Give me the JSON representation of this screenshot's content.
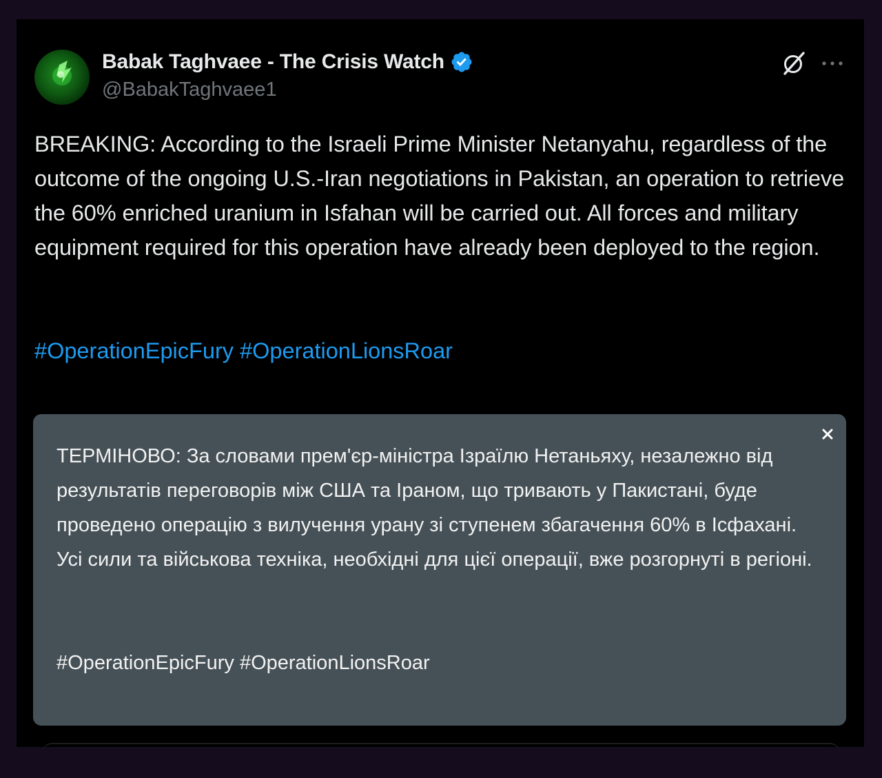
{
  "author": {
    "display_name": "Babak Taghvaee - The Crisis Watch",
    "handle": "@BabakTaghvaee1",
    "verified": true,
    "verified_color": "#1d9bf0"
  },
  "tweet": {
    "text": "BREAKING: According to the Israeli Prime Minister Netanyahu, regardless of the outcome of the ongoing U.S.-Iran negotiations in Pakistan, an operation to retrieve the 60% enriched uranium in Isfahan will be carried out. All forces and military equipment required for this operation have already been deployed to the region.",
    "hashtags": [
      "#OperationEpicFury",
      "#OperationLionsRoar"
    ],
    "hashtag_color": "#1d9bf0"
  },
  "translation": {
    "text": "ТЕРМІНОВО: За словами прем'єр-міністра Ізраїлю Нетаньяху, незалежно від результатів переговорів між США та Іраном, що тривають у Пакистані, буде проведено операцію з вилучення урану зі ступенем збагачення 60% в Ісфахані. Усі сили та військова техніка, необхідні для цієї операції, вже розгорнуті в регіоні.",
    "hashtags": "#OperationEpicFury #OperationLionsRoar",
    "background": "#465157"
  },
  "icons": {
    "avatar": "green-glow-avatar",
    "verified": "verified-badge-icon",
    "grok": "grok-icon",
    "more": "more-options-icon",
    "close": "close-icon"
  },
  "colors": {
    "page_background": "#150d1e",
    "card_background": "#000000",
    "primary_text": "#e7e9ea",
    "secondary_text": "#71767b"
  }
}
